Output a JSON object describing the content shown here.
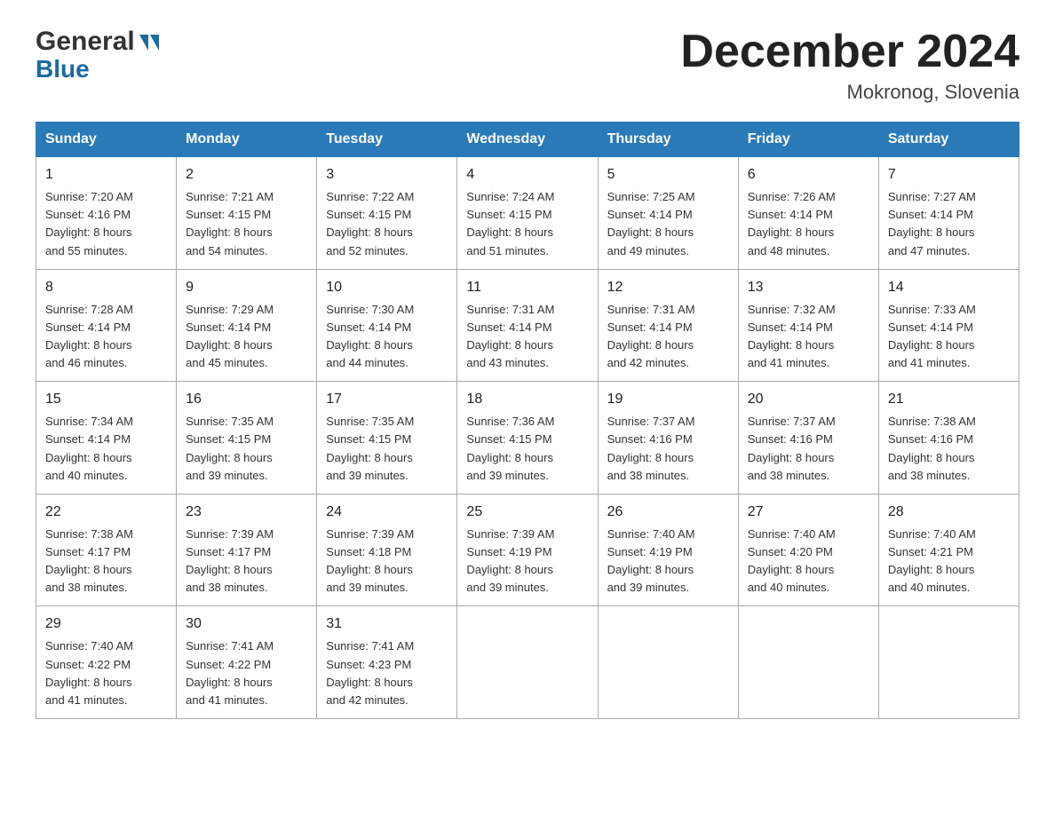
{
  "header": {
    "logo_general": "General",
    "logo_blue": "Blue",
    "month_title": "December 2024",
    "location": "Mokronog, Slovenia"
  },
  "calendar": {
    "days_header": [
      "Sunday",
      "Monday",
      "Tuesday",
      "Wednesday",
      "Thursday",
      "Friday",
      "Saturday"
    ],
    "weeks": [
      [
        {
          "day": "1",
          "sunrise": "7:20 AM",
          "sunset": "4:16 PM",
          "daylight": "8 hours and 55 minutes."
        },
        {
          "day": "2",
          "sunrise": "7:21 AM",
          "sunset": "4:15 PM",
          "daylight": "8 hours and 54 minutes."
        },
        {
          "day": "3",
          "sunrise": "7:22 AM",
          "sunset": "4:15 PM",
          "daylight": "8 hours and 52 minutes."
        },
        {
          "day": "4",
          "sunrise": "7:24 AM",
          "sunset": "4:15 PM",
          "daylight": "8 hours and 51 minutes."
        },
        {
          "day": "5",
          "sunrise": "7:25 AM",
          "sunset": "4:14 PM",
          "daylight": "8 hours and 49 minutes."
        },
        {
          "day": "6",
          "sunrise": "7:26 AM",
          "sunset": "4:14 PM",
          "daylight": "8 hours and 48 minutes."
        },
        {
          "day": "7",
          "sunrise": "7:27 AM",
          "sunset": "4:14 PM",
          "daylight": "8 hours and 47 minutes."
        }
      ],
      [
        {
          "day": "8",
          "sunrise": "7:28 AM",
          "sunset": "4:14 PM",
          "daylight": "8 hours and 46 minutes."
        },
        {
          "day": "9",
          "sunrise": "7:29 AM",
          "sunset": "4:14 PM",
          "daylight": "8 hours and 45 minutes."
        },
        {
          "day": "10",
          "sunrise": "7:30 AM",
          "sunset": "4:14 PM",
          "daylight": "8 hours and 44 minutes."
        },
        {
          "day": "11",
          "sunrise": "7:31 AM",
          "sunset": "4:14 PM",
          "daylight": "8 hours and 43 minutes."
        },
        {
          "day": "12",
          "sunrise": "7:31 AM",
          "sunset": "4:14 PM",
          "daylight": "8 hours and 42 minutes."
        },
        {
          "day": "13",
          "sunrise": "7:32 AM",
          "sunset": "4:14 PM",
          "daylight": "8 hours and 41 minutes."
        },
        {
          "day": "14",
          "sunrise": "7:33 AM",
          "sunset": "4:14 PM",
          "daylight": "8 hours and 41 minutes."
        }
      ],
      [
        {
          "day": "15",
          "sunrise": "7:34 AM",
          "sunset": "4:14 PM",
          "daylight": "8 hours and 40 minutes."
        },
        {
          "day": "16",
          "sunrise": "7:35 AM",
          "sunset": "4:15 PM",
          "daylight": "8 hours and 39 minutes."
        },
        {
          "day": "17",
          "sunrise": "7:35 AM",
          "sunset": "4:15 PM",
          "daylight": "8 hours and 39 minutes."
        },
        {
          "day": "18",
          "sunrise": "7:36 AM",
          "sunset": "4:15 PM",
          "daylight": "8 hours and 39 minutes."
        },
        {
          "day": "19",
          "sunrise": "7:37 AM",
          "sunset": "4:16 PM",
          "daylight": "8 hours and 38 minutes."
        },
        {
          "day": "20",
          "sunrise": "7:37 AM",
          "sunset": "4:16 PM",
          "daylight": "8 hours and 38 minutes."
        },
        {
          "day": "21",
          "sunrise": "7:38 AM",
          "sunset": "4:16 PM",
          "daylight": "8 hours and 38 minutes."
        }
      ],
      [
        {
          "day": "22",
          "sunrise": "7:38 AM",
          "sunset": "4:17 PM",
          "daylight": "8 hours and 38 minutes."
        },
        {
          "day": "23",
          "sunrise": "7:39 AM",
          "sunset": "4:17 PM",
          "daylight": "8 hours and 38 minutes."
        },
        {
          "day": "24",
          "sunrise": "7:39 AM",
          "sunset": "4:18 PM",
          "daylight": "8 hours and 39 minutes."
        },
        {
          "day": "25",
          "sunrise": "7:39 AM",
          "sunset": "4:19 PM",
          "daylight": "8 hours and 39 minutes."
        },
        {
          "day": "26",
          "sunrise": "7:40 AM",
          "sunset": "4:19 PM",
          "daylight": "8 hours and 39 minutes."
        },
        {
          "day": "27",
          "sunrise": "7:40 AM",
          "sunset": "4:20 PM",
          "daylight": "8 hours and 40 minutes."
        },
        {
          "day": "28",
          "sunrise": "7:40 AM",
          "sunset": "4:21 PM",
          "daylight": "8 hours and 40 minutes."
        }
      ],
      [
        {
          "day": "29",
          "sunrise": "7:40 AM",
          "sunset": "4:22 PM",
          "daylight": "8 hours and 41 minutes."
        },
        {
          "day": "30",
          "sunrise": "7:41 AM",
          "sunset": "4:22 PM",
          "daylight": "8 hours and 41 minutes."
        },
        {
          "day": "31",
          "sunrise": "7:41 AM",
          "sunset": "4:23 PM",
          "daylight": "8 hours and 42 minutes."
        },
        null,
        null,
        null,
        null
      ]
    ]
  }
}
